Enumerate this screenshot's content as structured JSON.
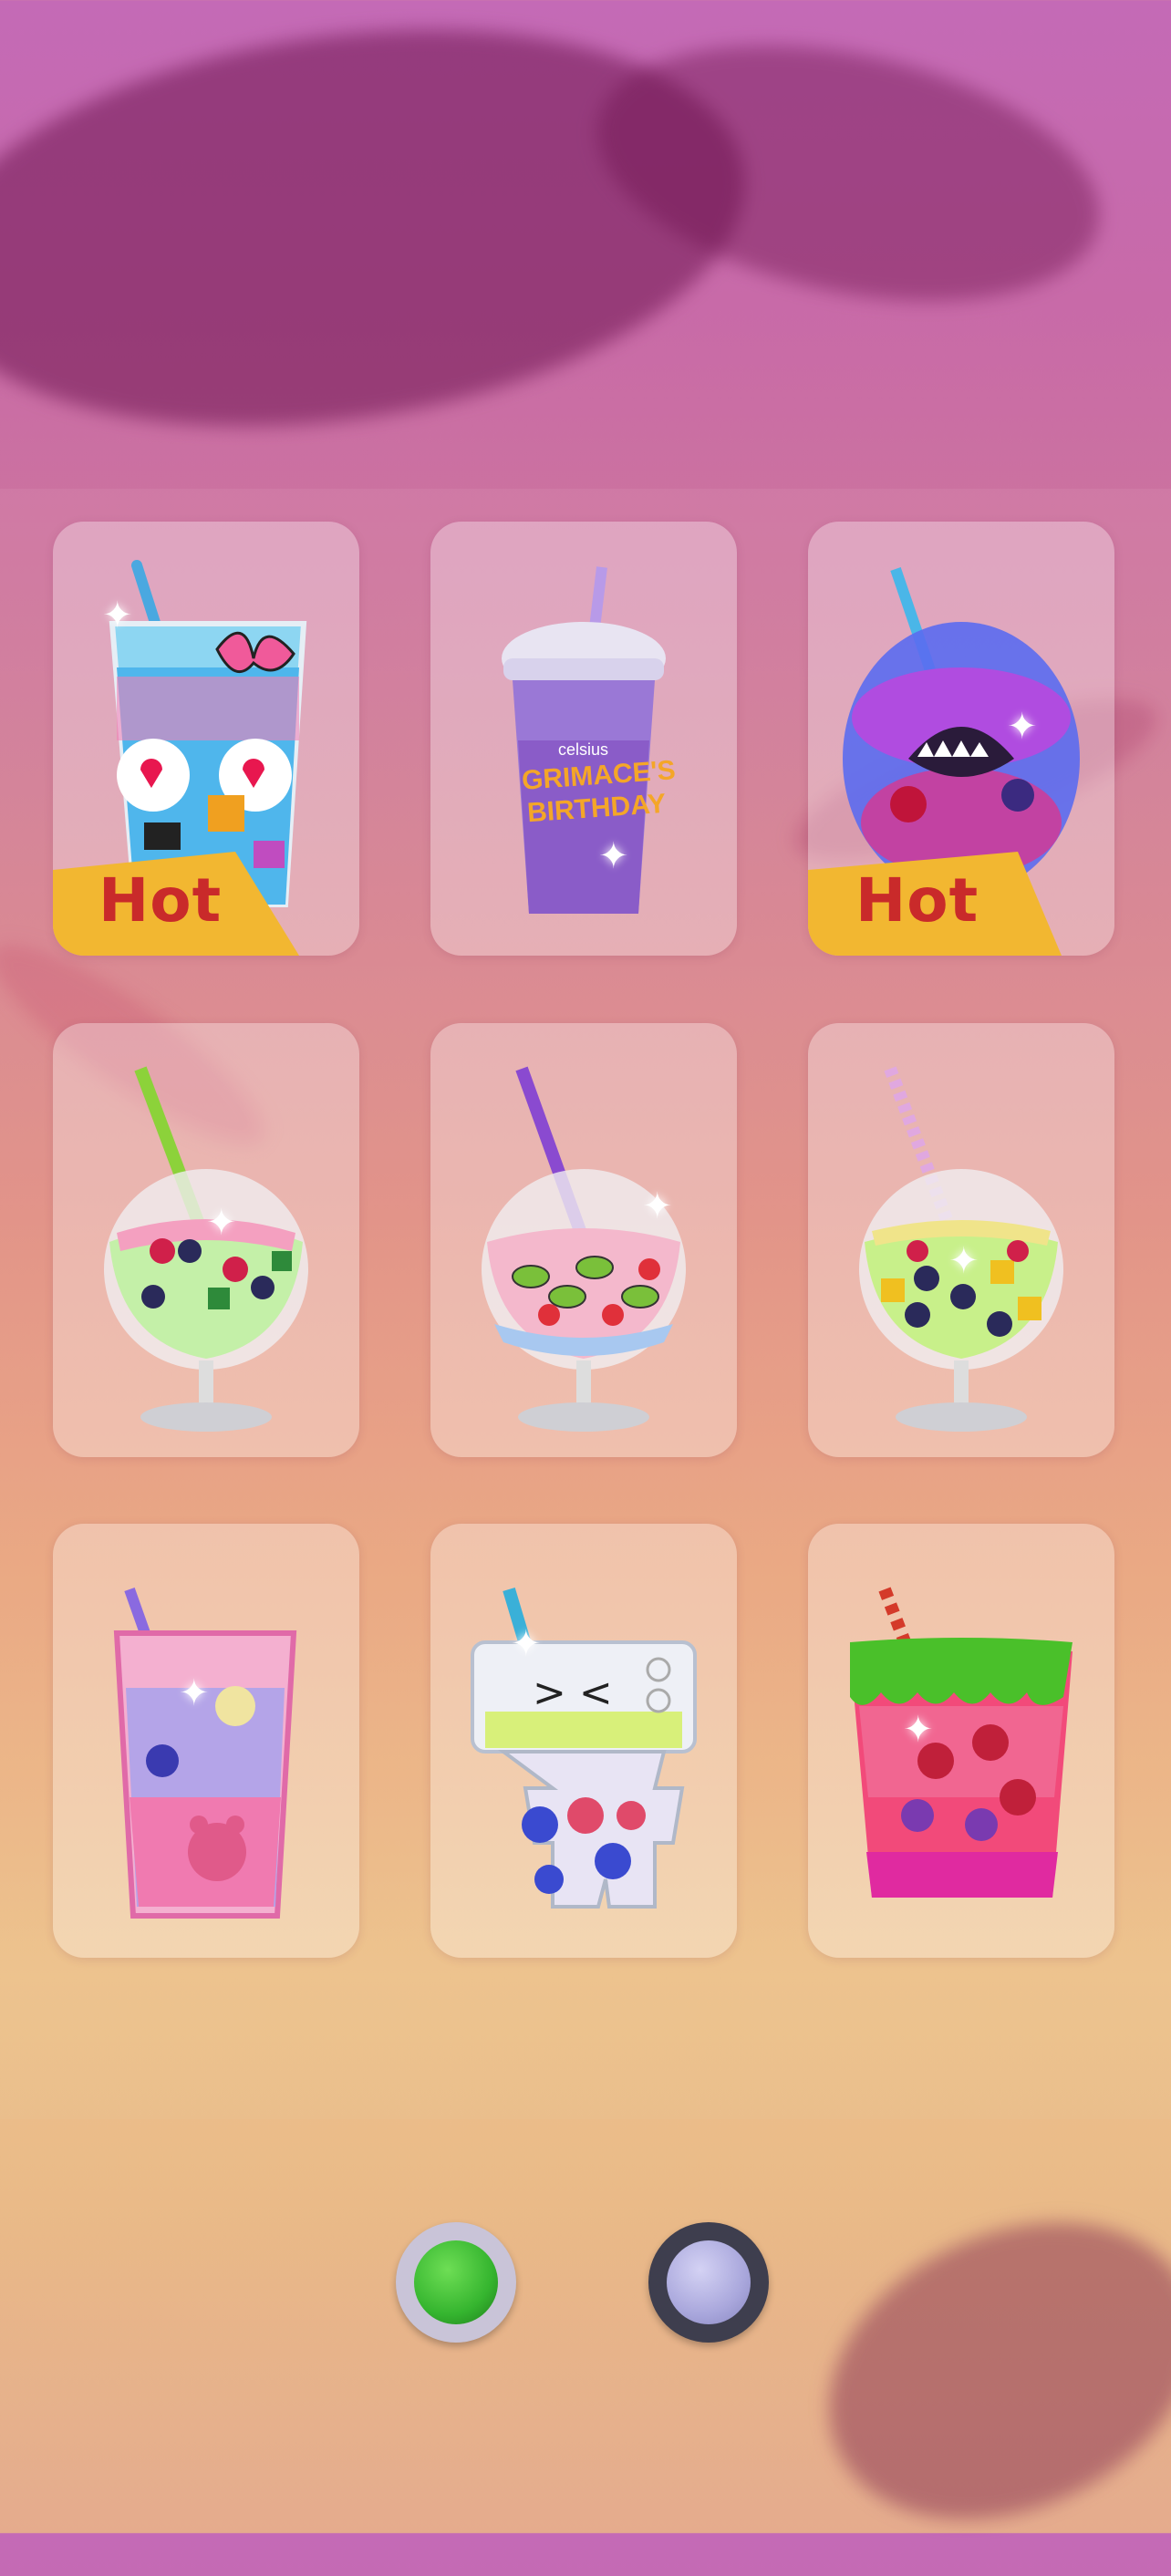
{
  "grid": {
    "items": [
      {
        "id": "cup-bow-hearts",
        "hot": true
      },
      {
        "id": "cup-grimace",
        "hot": false
      },
      {
        "id": "cup-monster-bowl",
        "hot": true
      },
      {
        "id": "glass-green-straw",
        "hot": false
      },
      {
        "id": "glass-kiwi-strawberry",
        "hot": false
      },
      {
        "id": "glass-fruit-mix",
        "hot": false
      },
      {
        "id": "cup-bear",
        "hot": false
      },
      {
        "id": "cup-robot",
        "hot": false
      },
      {
        "id": "cup-watermelon",
        "hot": false
      }
    ],
    "hot_label": "Hot",
    "grimace_brand": "celsius",
    "grimace_line1": "GRIMACE'S",
    "grimace_line2": "BIRTHDAY"
  },
  "pager": {
    "pages": 2,
    "current": 1,
    "active_color": "#35b52f",
    "inactive_color": "#a9a7dc"
  }
}
